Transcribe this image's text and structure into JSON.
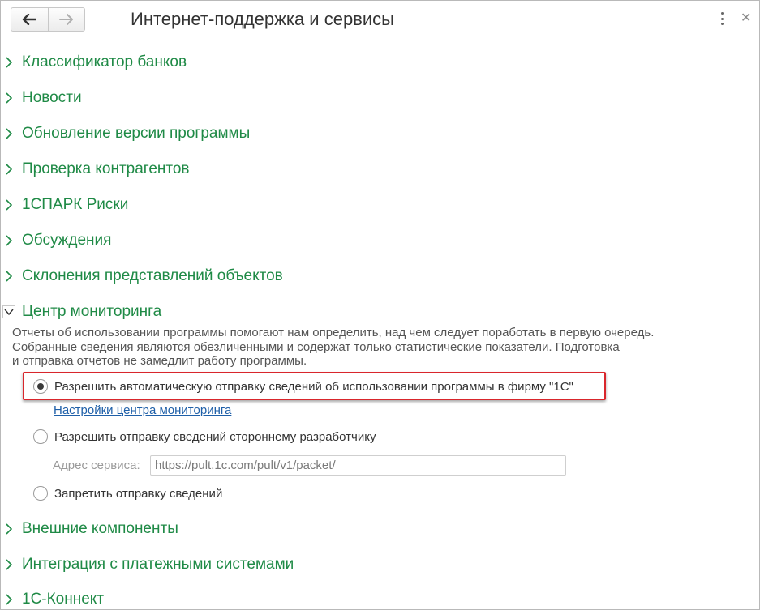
{
  "window": {
    "title": "Интернет-поддержка и сервисы"
  },
  "sections": {
    "banks": "Классификатор банков",
    "news": "Новости",
    "update": "Обновление версии программы",
    "contractors": "Проверка контрагентов",
    "spark": "1СПАРК Риски",
    "discussions": "Обсуждения",
    "declension": "Склонения представлений объектов",
    "monitoring": "Центр мониторинга",
    "components": "Внешние компоненты",
    "payments": "Интеграция с платежными системами",
    "connect": "1С-Коннект"
  },
  "monitoring": {
    "description": [
      "Отчеты об использовании программы помогают нам определить, над чем следует поработать в первую очередь.",
      "Собранные сведения являются обезличенными и содержат только статистические показатели. Подготовка",
      "и отправка отчетов не замедлит работу программы."
    ],
    "options": [
      {
        "label": "Разрешить автоматическую отправку сведений об использовании программы в фирму \"1С\"",
        "selected": true
      },
      {
        "label": "Разрешить отправку сведений стороннему разработчику",
        "selected": false
      },
      {
        "label": "Запретить отправку сведений",
        "selected": false
      }
    ],
    "settings_link": "Настройки центра мониторинга",
    "address_label": "Адрес сервиса:",
    "address_value": "https://pult.1c.com/pult/v1/packet/"
  },
  "colors": {
    "section_text": "#1f8a46",
    "link": "#1e5fa8",
    "highlight_border": "#d9262c"
  }
}
